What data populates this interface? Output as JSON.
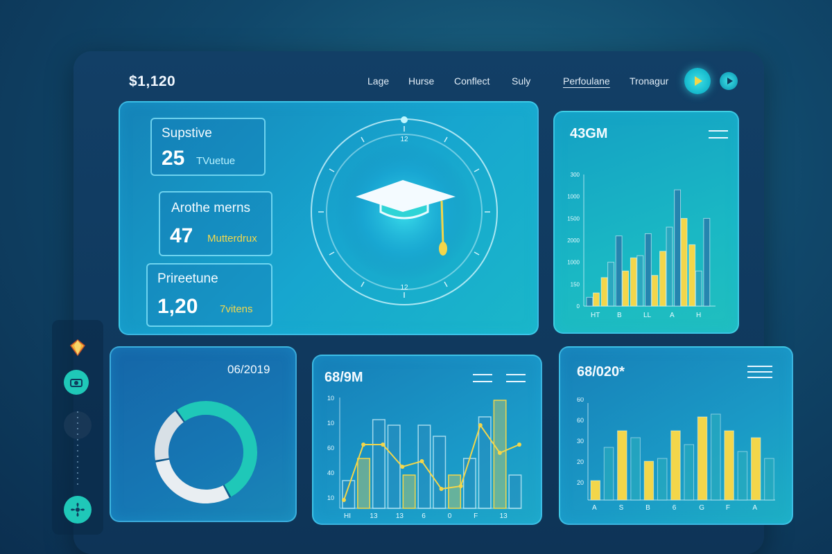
{
  "header": {
    "brand": "$1,120",
    "nav": [
      "Lage",
      "Hurse",
      "Conflect",
      "Suly",
      "Perfoulane",
      "Tronagur"
    ]
  },
  "stats": [
    {
      "label": "Supstive",
      "value": "25",
      "unit": "TVuetue"
    },
    {
      "label": "Arothe merns",
      "value": "47",
      "unit": "Mutterdrux"
    },
    {
      "label": "Prireetune",
      "value": "1,20",
      "unit": "7vitens"
    }
  ],
  "hero": {
    "icon": "graduation-cap-icon",
    "dial_top": "12",
    "dial_bottom": "12"
  },
  "colors": {
    "accent_cyan": "#3fe0e6",
    "accent_yellow": "#f3d64a",
    "teal": "#1fc8b8"
  },
  "chart_data": [
    {
      "type": "bar",
      "title": "43GM",
      "categories": [
        "HT",
        "B",
        "LL",
        "A",
        "H"
      ],
      "yticks": [
        "0",
        "150",
        "1000",
        "2000",
        "1500",
        "1000",
        "300"
      ],
      "ylim": [
        0,
        6
      ],
      "series": [
        {
          "values": [
            0.4,
            1.3,
            3.2,
            2.2,
            3.3,
            2.5,
            5.3,
            2.8,
            4.0
          ]
        },
        {
          "values": [
            0.6,
            2.0,
            1.6,
            2.3,
            1.4,
            3.6,
            4.0,
            1.6
          ]
        }
      ]
    },
    {
      "type": "donut",
      "title": "06/2019",
      "values": [
        52,
        30,
        18
      ]
    },
    {
      "type": "bar",
      "title": "68/9M",
      "categories": [
        "HI",
        "13",
        "13",
        "6",
        "0",
        "F",
        "13"
      ],
      "yticks": [
        "10",
        "40",
        "60",
        "10",
        "10"
      ],
      "ylim": [
        0,
        80
      ],
      "bars": [
        20,
        36,
        64,
        60,
        24,
        60,
        52,
        24,
        36,
        66,
        78,
        24
      ],
      "line": [
        6,
        46,
        46,
        30,
        34,
        14,
        16,
        60,
        40,
        46
      ]
    },
    {
      "type": "bar",
      "title": "68/020*",
      "categories": [
        "A",
        "S",
        "B",
        "6",
        "G",
        "F",
        "A"
      ],
      "yticks": [
        "20",
        "20",
        "30",
        "60",
        "60"
      ],
      "ylim": [
        0,
        70
      ],
      "bars": [
        14,
        38,
        50,
        45,
        28,
        30,
        50,
        40,
        60,
        62,
        50,
        35,
        45,
        30
      ]
    }
  ],
  "sidebar": {
    "icons": [
      "gem-icon",
      "camera-icon",
      "timeline-icon",
      "fan-icon"
    ]
  }
}
